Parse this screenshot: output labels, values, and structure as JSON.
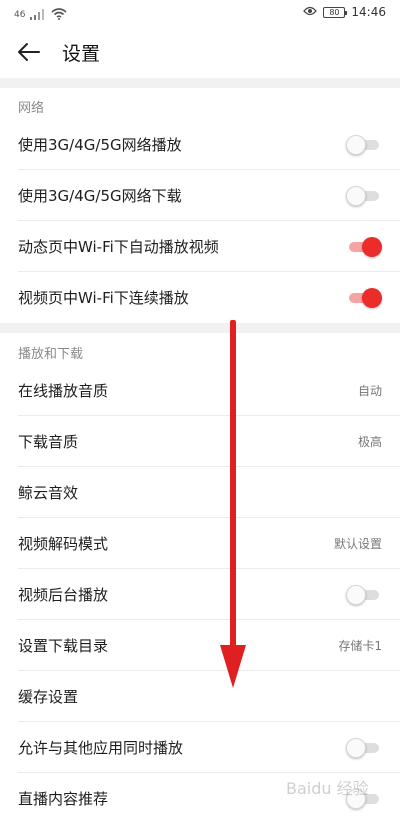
{
  "status_bar": {
    "time": "14:46",
    "network_text": "46",
    "battery": "80"
  },
  "header": {
    "title": "设置"
  },
  "sections": [
    {
      "title": "网络"
    },
    {
      "title": "播放和下载"
    }
  ],
  "rows": [
    {
      "label": "使用3G/4G/5G网络播放",
      "control": "toggle",
      "on": false
    },
    {
      "label": "使用3G/4G/5G网络下载",
      "control": "toggle",
      "on": false
    },
    {
      "label": "动态页中Wi-Fi下自动播放视频",
      "control": "toggle",
      "on": true
    },
    {
      "label": "视频页中Wi-Fi下连续播放",
      "control": "toggle",
      "on": true
    },
    {
      "label": "在线播放音质",
      "control": "value",
      "value": "自动"
    },
    {
      "label": "下载音质",
      "control": "value",
      "value": "极高"
    },
    {
      "label": "鲸云音效",
      "control": "none"
    },
    {
      "label": "视频解码模式",
      "control": "value",
      "value": "默认设置"
    },
    {
      "label": "视频后台播放",
      "control": "toggle",
      "on": false
    },
    {
      "label": "设置下载目录",
      "control": "value",
      "value": "存储卡1"
    },
    {
      "label": "缓存设置",
      "control": "none"
    },
    {
      "label": "允许与其他应用同时播放",
      "control": "toggle",
      "on": false
    },
    {
      "label": "直播内容推荐",
      "control": "toggle",
      "on": false
    }
  ],
  "colors": {
    "accent": "#ec2b2b",
    "annotation_arrow": "#e02020"
  },
  "watermark": {
    "text": "Baidu 经验"
  }
}
